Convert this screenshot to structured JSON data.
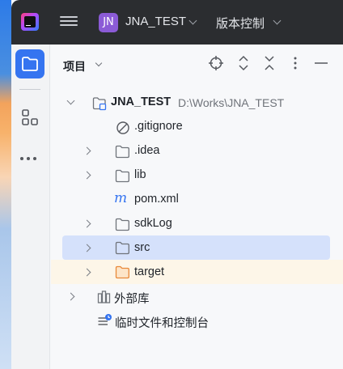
{
  "titlebar": {
    "project_badge": "JN",
    "project_name": "JNA_TEST",
    "vcs_label": "版本控制"
  },
  "panel": {
    "title": "项目"
  },
  "tree": {
    "root": {
      "label": "JNA_TEST",
      "path": "D:\\Works\\JNA_TEST"
    },
    "items": [
      {
        "label": ".gitignore",
        "icon": "gitignore-icon"
      },
      {
        "label": ".idea",
        "icon": "folder-icon"
      },
      {
        "label": "lib",
        "icon": "folder-icon"
      },
      {
        "label": "pom.xml",
        "icon": "maven-icon"
      },
      {
        "label": "sdkLog",
        "icon": "folder-icon"
      },
      {
        "label": "src",
        "icon": "folder-icon"
      },
      {
        "label": "target",
        "icon": "excluded-folder-icon"
      }
    ],
    "external_libraries": "外部库",
    "scratches": "临时文件和控制台"
  },
  "colors": {
    "accent": "#3574f0",
    "selection": "#d5e1fb",
    "excluded_bg": "#fdf6e8",
    "titlebar_bg": "#2b2d30"
  }
}
